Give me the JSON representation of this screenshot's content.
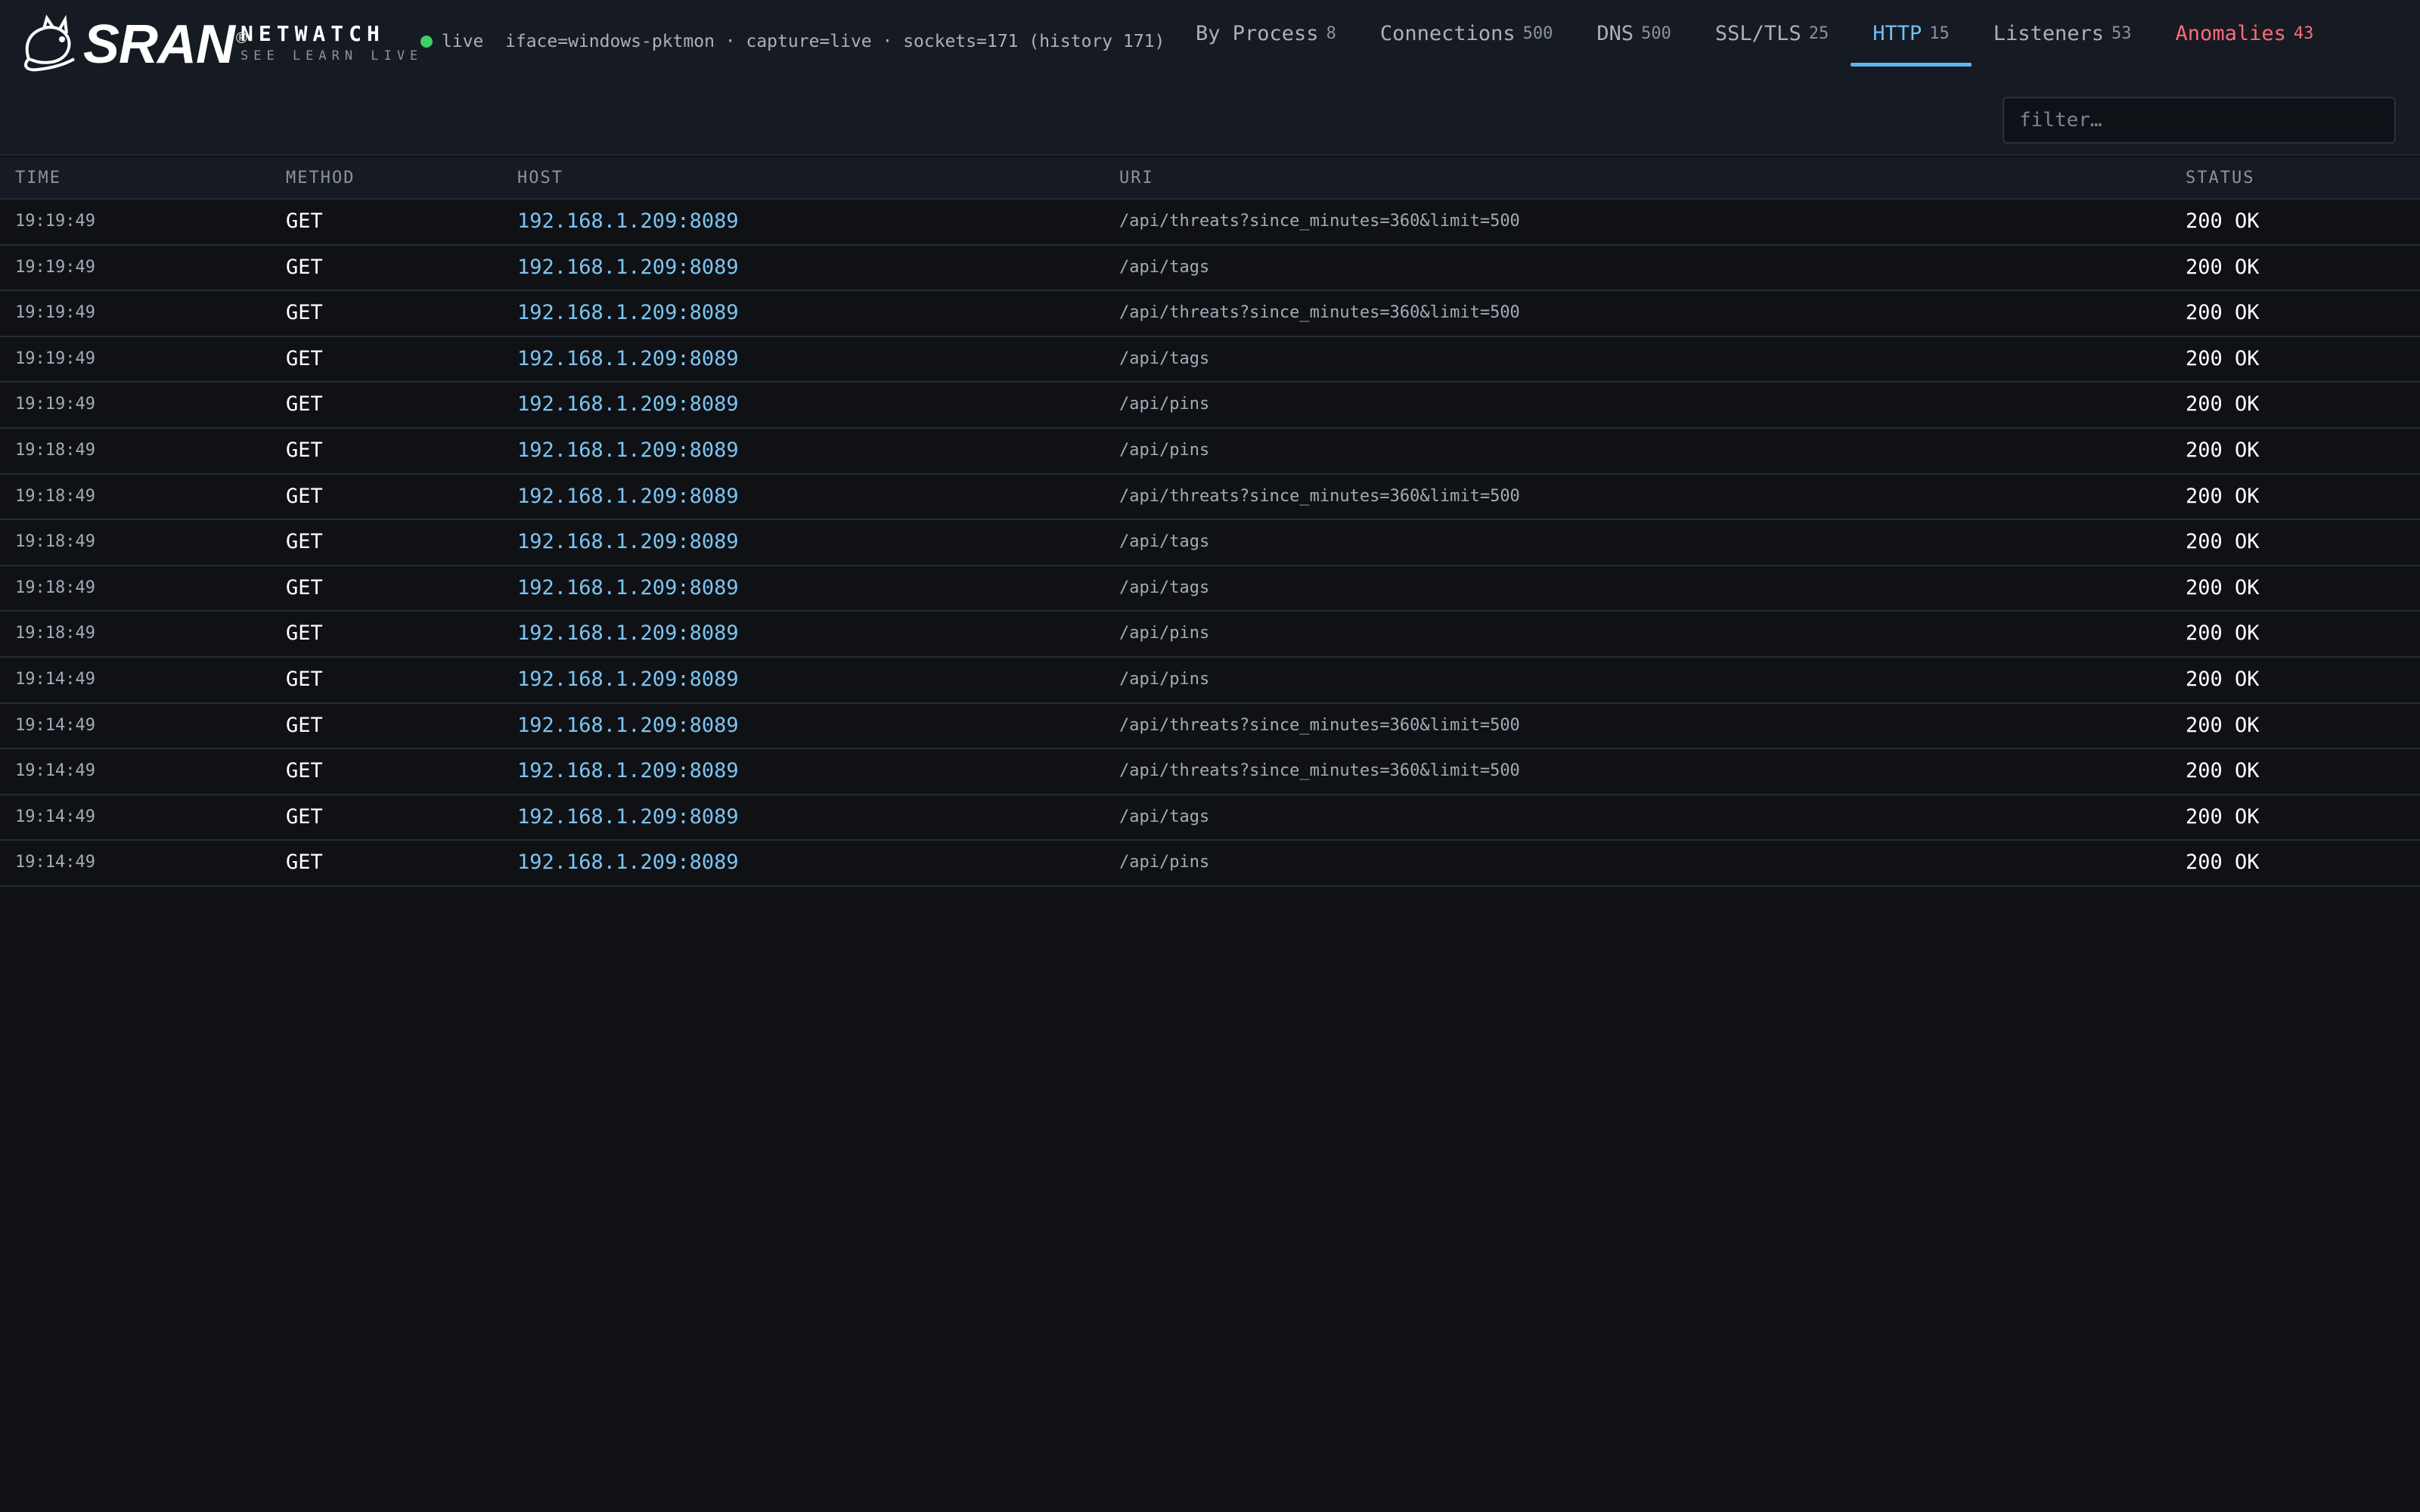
{
  "brand": {
    "logo_word": "SRAN",
    "reg_mark": "®",
    "name": "NETWATCH",
    "tagline": "SEE LEARN LIVE"
  },
  "status": {
    "live_label": "live",
    "meta": "iface=windows-pktmon · capture=live · sockets=171 (history 171)",
    "dot_color": "#3ccf6a"
  },
  "tabs": [
    {
      "label": "By Process",
      "count": "8"
    },
    {
      "label": "Connections",
      "count": "500"
    },
    {
      "label": "DNS",
      "count": "500"
    },
    {
      "label": "SSL/TLS",
      "count": "25"
    },
    {
      "label": "HTTP",
      "count": "15",
      "active": true
    },
    {
      "label": "Listeners",
      "count": "53"
    },
    {
      "label": "Anomalies",
      "count": "43",
      "alert": true
    }
  ],
  "filter": {
    "placeholder": "filter…",
    "value": ""
  },
  "table": {
    "headers": {
      "time": "TIME",
      "method": "METHOD",
      "host": "HOST",
      "uri": "URI",
      "status": "STATUS"
    },
    "rows": [
      {
        "time": "19:19:49",
        "method": "GET",
        "host": "192.168.1.209:8089",
        "uri": "/api/threats?since_minutes=360&limit=500",
        "status": "200 OK"
      },
      {
        "time": "19:19:49",
        "method": "GET",
        "host": "192.168.1.209:8089",
        "uri": "/api/tags",
        "status": "200 OK"
      },
      {
        "time": "19:19:49",
        "method": "GET",
        "host": "192.168.1.209:8089",
        "uri": "/api/threats?since_minutes=360&limit=500",
        "status": "200 OK"
      },
      {
        "time": "19:19:49",
        "method": "GET",
        "host": "192.168.1.209:8089",
        "uri": "/api/tags",
        "status": "200 OK"
      },
      {
        "time": "19:19:49",
        "method": "GET",
        "host": "192.168.1.209:8089",
        "uri": "/api/pins",
        "status": "200 OK"
      },
      {
        "time": "19:18:49",
        "method": "GET",
        "host": "192.168.1.209:8089",
        "uri": "/api/pins",
        "status": "200 OK"
      },
      {
        "time": "19:18:49",
        "method": "GET",
        "host": "192.168.1.209:8089",
        "uri": "/api/threats?since_minutes=360&limit=500",
        "status": "200 OK"
      },
      {
        "time": "19:18:49",
        "method": "GET",
        "host": "192.168.1.209:8089",
        "uri": "/api/tags",
        "status": "200 OK"
      },
      {
        "time": "19:18:49",
        "method": "GET",
        "host": "192.168.1.209:8089",
        "uri": "/api/tags",
        "status": "200 OK"
      },
      {
        "time": "19:18:49",
        "method": "GET",
        "host": "192.168.1.209:8089",
        "uri": "/api/pins",
        "status": "200 OK"
      },
      {
        "time": "19:14:49",
        "method": "GET",
        "host": "192.168.1.209:8089",
        "uri": "/api/pins",
        "status": "200 OK"
      },
      {
        "time": "19:14:49",
        "method": "GET",
        "host": "192.168.1.209:8089",
        "uri": "/api/threats?since_minutes=360&limit=500",
        "status": "200 OK"
      },
      {
        "time": "19:14:49",
        "method": "GET",
        "host": "192.168.1.209:8089",
        "uri": "/api/threats?since_minutes=360&limit=500",
        "status": "200 OK"
      },
      {
        "time": "19:14:49",
        "method": "GET",
        "host": "192.168.1.209:8089",
        "uri": "/api/tags",
        "status": "200 OK"
      },
      {
        "time": "19:14:49",
        "method": "GET",
        "host": "192.168.1.209:8089",
        "uri": "/api/pins",
        "status": "200 OK"
      }
    ]
  }
}
